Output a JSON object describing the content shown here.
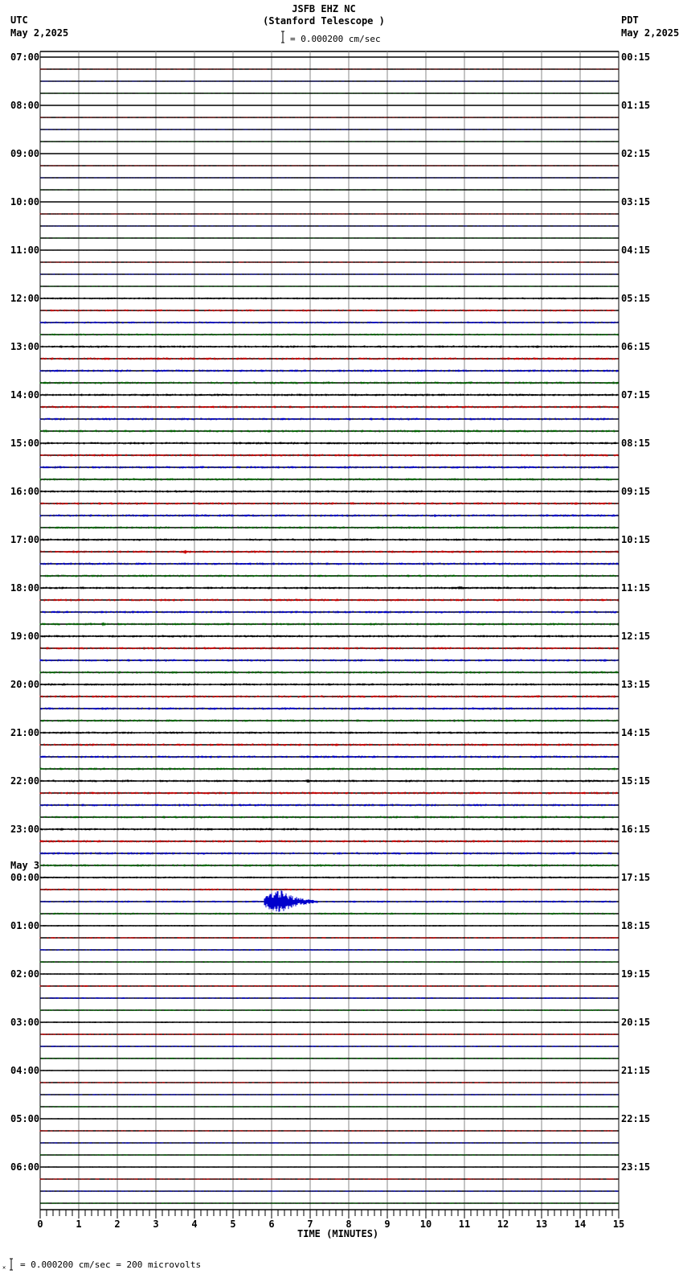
{
  "header": {
    "title": "JSFB EHZ NC",
    "subtitle": "(Stanford Telescope )",
    "scale_text": "= 0.000200 cm/sec",
    "left_tz": "UTC",
    "left_date": "May 2,2025",
    "right_tz": "PDT",
    "right_date": "May 2,2025"
  },
  "footer": {
    "scale_text": "= 0.000200 cm/sec =     200 microvolts"
  },
  "chart_data": {
    "type": "line",
    "title": "JSFB EHZ NC",
    "subtitle": "(Stanford Telescope )",
    "xlabel": "TIME (MINUTES)",
    "xlim": [
      0,
      15
    ],
    "x_ticks": [
      "0",
      "1",
      "2",
      "3",
      "4",
      "5",
      "6",
      "7",
      "8",
      "9",
      "10",
      "11",
      "12",
      "13",
      "14",
      "15"
    ],
    "minutes_per_line": 15,
    "lines": 96,
    "scale_cm_per_sec": 0.0002,
    "trace_colors": [
      "#000000",
      "#cc0000",
      "#0000cc",
      "#006600"
    ],
    "left_labels": [
      {
        "line": 0,
        "text": "07:00"
      },
      {
        "line": 4,
        "text": "08:00"
      },
      {
        "line": 8,
        "text": "09:00"
      },
      {
        "line": 12,
        "text": "10:00"
      },
      {
        "line": 16,
        "text": "11:00"
      },
      {
        "line": 20,
        "text": "12:00"
      },
      {
        "line": 24,
        "text": "13:00"
      },
      {
        "line": 28,
        "text": "14:00"
      },
      {
        "line": 32,
        "text": "15:00"
      },
      {
        "line": 36,
        "text": "16:00"
      },
      {
        "line": 40,
        "text": "17:00"
      },
      {
        "line": 44,
        "text": "18:00"
      },
      {
        "line": 48,
        "text": "19:00"
      },
      {
        "line": 52,
        "text": "20:00"
      },
      {
        "line": 56,
        "text": "21:00"
      },
      {
        "line": 60,
        "text": "22:00"
      },
      {
        "line": 64,
        "text": "23:00"
      },
      {
        "line": 68,
        "text": "00:00",
        "date": "May 3"
      },
      {
        "line": 72,
        "text": "01:00"
      },
      {
        "line": 76,
        "text": "02:00"
      },
      {
        "line": 80,
        "text": "03:00"
      },
      {
        "line": 84,
        "text": "04:00"
      },
      {
        "line": 88,
        "text": "05:00"
      },
      {
        "line": 92,
        "text": "06:00"
      }
    ],
    "right_labels": [
      {
        "line": 0,
        "text": "00:15"
      },
      {
        "line": 4,
        "text": "01:15"
      },
      {
        "line": 8,
        "text": "02:15"
      },
      {
        "line": 12,
        "text": "03:15"
      },
      {
        "line": 16,
        "text": "04:15"
      },
      {
        "line": 20,
        "text": "05:15"
      },
      {
        "line": 24,
        "text": "06:15"
      },
      {
        "line": 28,
        "text": "07:15"
      },
      {
        "line": 32,
        "text": "08:15"
      },
      {
        "line": 36,
        "text": "09:15"
      },
      {
        "line": 40,
        "text": "10:15"
      },
      {
        "line": 44,
        "text": "11:15"
      },
      {
        "line": 48,
        "text": "12:15"
      },
      {
        "line": 52,
        "text": "13:15"
      },
      {
        "line": 56,
        "text": "14:15"
      },
      {
        "line": 60,
        "text": "15:15"
      },
      {
        "line": 64,
        "text": "16:15"
      },
      {
        "line": 68,
        "text": "17:15"
      },
      {
        "line": 72,
        "text": "18:15"
      },
      {
        "line": 76,
        "text": "19:15"
      },
      {
        "line": 80,
        "text": "20:15"
      },
      {
        "line": 84,
        "text": "21:15"
      },
      {
        "line": 88,
        "text": "22:15"
      },
      {
        "line": 92,
        "text": "23:15"
      }
    ],
    "noise_by_hour_cm_per_sec": [
      8e-06,
      8e-06,
      8e-06,
      1e-05,
      1.2e-05,
      2.5e-05,
      3e-05,
      3e-05,
      3e-05,
      3e-05,
      3e-05,
      3e-05,
      3e-05,
      3e-05,
      3e-05,
      3e-05,
      3e-05,
      2.5e-05,
      2e-05,
      2e-05,
      2e-05,
      1.5e-05,
      1.5e-05,
      1.5e-05
    ],
    "events": [
      {
        "line": 70,
        "start_min": 5.8,
        "duration_min": 1.4,
        "peak_cm_per_sec": 0.0003
      },
      {
        "line": 44,
        "start_min": 10.8,
        "duration_min": 0.4,
        "peak_cm_per_sec": 6e-05
      },
      {
        "line": 41,
        "start_min": 3.7,
        "duration_min": 0.2,
        "peak_cm_per_sec": 6e-05
      },
      {
        "line": 47,
        "start_min": 1.6,
        "duration_min": 0.15,
        "peak_cm_per_sec": 7e-05
      },
      {
        "line": 38,
        "start_min": 10.2,
        "duration_min": 0.15,
        "peak_cm_per_sec": 6e-05
      },
      {
        "line": 60,
        "start_min": 6.8,
        "duration_min": 0.5,
        "peak_cm_per_sec": 4e-05
      },
      {
        "line": 34,
        "start_min": 11.6,
        "duration_min": 0.15,
        "peak_cm_per_sec": 5e-05
      }
    ]
  }
}
